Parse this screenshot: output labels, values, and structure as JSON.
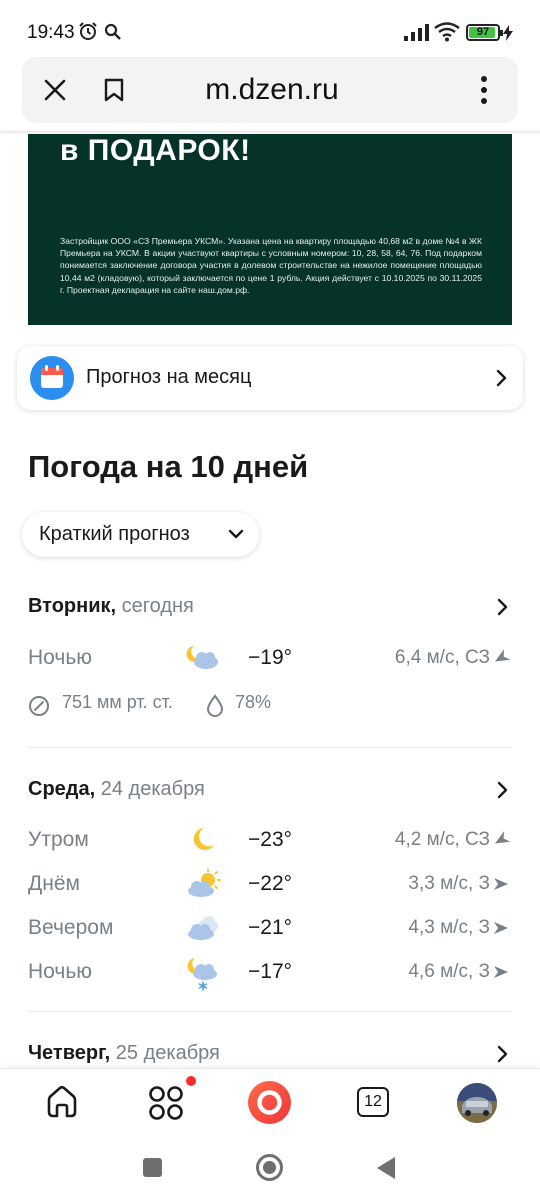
{
  "status_bar": {
    "time": "19:43",
    "battery": "97"
  },
  "browser": {
    "url": "m.dzen.ru"
  },
  "ad": {
    "title": "в ПОДАРОК!",
    "legal": "Застройщик ООО «СЗ Премьера УКСМ». Указана цена на квартиру площадью 40,68 м2 в доме №4 в ЖК Премьера на УКСМ. В акции участвуют квартиры с условным номером: 10, 28, 58, 64, 76. Под подарком понимается заключение договора участия в долевом строительстве на нежилое помещение площадью 10,44 м2 (кладовую), который заключается по цене 1 рубль. Акция действует с 10.10.2025 по 30.11.2025 г. Проектная декларация на сайте наш.дом.рф."
  },
  "month_card": {
    "label": "Прогноз на месяц"
  },
  "heading": "Погода на 10 дней",
  "view_select": {
    "label": "Краткий прогноз"
  },
  "days": [
    {
      "weekday": "Вторник,",
      "date": "сегодня",
      "rows": [
        {
          "part": "Ночью",
          "icon": "night-cloudy-icon",
          "temp": "−19°",
          "wind": "6,4 м/с, СЗ"
        }
      ],
      "pressure": "751 мм рт. ст.",
      "humidity": "78%"
    },
    {
      "weekday": "Среда,",
      "date": "24 декабря",
      "rows": [
        {
          "part": "Утром",
          "icon": "moon-icon",
          "temp": "−23°",
          "wind": "4,2 м/с, СЗ"
        },
        {
          "part": "Днём",
          "icon": "partly-sunny-icon",
          "temp": "−22°",
          "wind": "3,3 м/с, З"
        },
        {
          "part": "Вечером",
          "icon": "cloudy-icon",
          "temp": "−21°",
          "wind": "4,3 м/с, З"
        },
        {
          "part": "Ночью",
          "icon": "night-snow-icon",
          "temp": "−17°",
          "wind": "4,6 м/с, З"
        }
      ]
    },
    {
      "weekday": "Четверг,",
      "date": "25 декабря"
    }
  ],
  "bottom_nav": {
    "tabs_count": "12"
  },
  "colors": {
    "ad_bg": "#053329",
    "accent_blue": "#2b8ef0",
    "alice_red": "#f0343a",
    "notification": "#ff2b2b"
  }
}
